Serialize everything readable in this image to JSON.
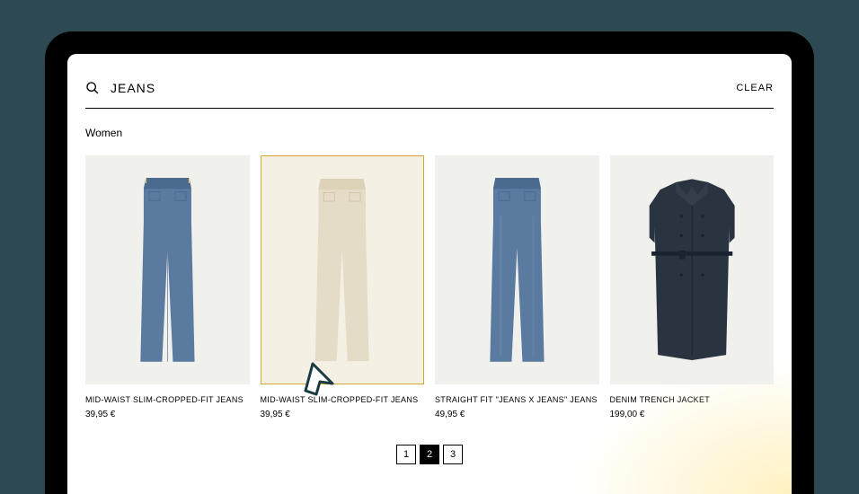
{
  "search": {
    "value": "JEANS",
    "clear_label": "CLEAR"
  },
  "category": "Women",
  "products": [
    {
      "name": "MID-WAIST SLIM-CROPPED-FIT JEANS",
      "price": "39,95 €"
    },
    {
      "name": "MID-WAIST SLIM-CROPPED-FIT JEANS",
      "price": "39,95 €"
    },
    {
      "name": "STRAIGHT FIT \"JEANS X JEANS\" JEANS",
      "price": "49,95 €"
    },
    {
      "name": "DENIM TRENCH JACKET",
      "price": "199,00 €"
    }
  ],
  "pagination": {
    "pages": [
      "1",
      "2",
      "3"
    ],
    "active": 1
  },
  "colors": {
    "denim_blue": "#5a7aa0",
    "denim_light": "#7a96b8",
    "beige": "#e5dcc8",
    "dark_navy": "#2a3440"
  }
}
